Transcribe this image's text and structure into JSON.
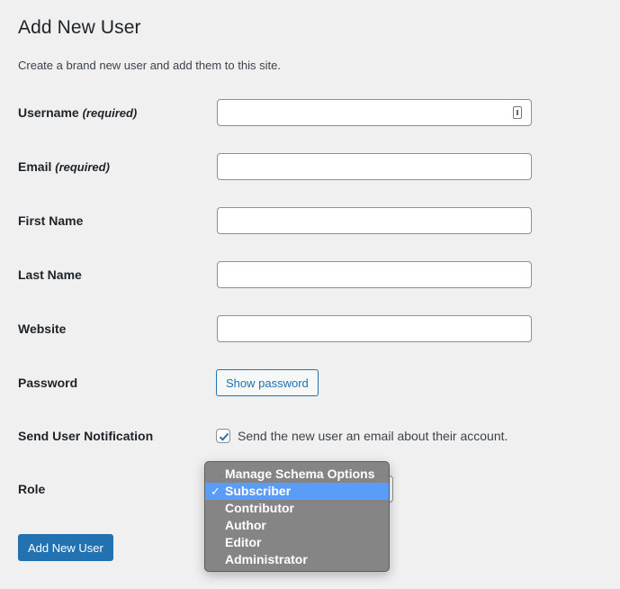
{
  "header": {
    "title": "Add New User",
    "description": "Create a brand new user and add them to this site."
  },
  "form": {
    "username": {
      "label": "Username",
      "required": "(required)",
      "value": "",
      "icon": "password-manager-key-icon"
    },
    "email": {
      "label": "Email",
      "required": "(required)",
      "value": ""
    },
    "first_name": {
      "label": "First Name",
      "value": ""
    },
    "last_name": {
      "label": "Last Name",
      "value": ""
    },
    "website": {
      "label": "Website",
      "value": ""
    },
    "password": {
      "label": "Password",
      "button_label": "Show password"
    },
    "notification": {
      "label": "Send User Notification",
      "checkbox_label": "Send the new user an email about their account.",
      "checked": true
    },
    "role": {
      "label": "Role",
      "selected": "Subscriber",
      "options": [
        {
          "label": "Manage Schema Options",
          "selected": false
        },
        {
          "label": "Subscriber",
          "selected": true
        },
        {
          "label": "Contributor",
          "selected": false
        },
        {
          "label": "Author",
          "selected": false
        },
        {
          "label": "Editor",
          "selected": false
        },
        {
          "label": "Administrator",
          "selected": false
        }
      ],
      "check_glyph": "✓"
    },
    "submit_label": "Add New User"
  },
  "colors": {
    "accent": "#2271b1",
    "background": "#f0f0f1",
    "dropdown_highlight": "#5a9cf8",
    "dropdown_background": "#808080"
  }
}
